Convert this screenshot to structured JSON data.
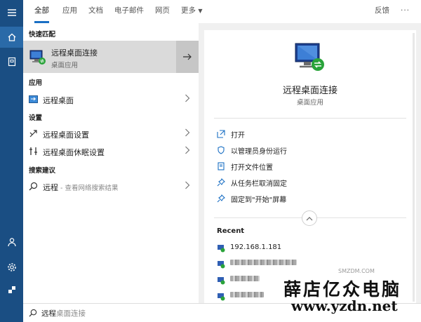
{
  "tabs": [
    {
      "label": "全部"
    },
    {
      "label": "应用"
    },
    {
      "label": "文档"
    },
    {
      "label": "电子邮件"
    },
    {
      "label": "网页"
    },
    {
      "label": "更多"
    }
  ],
  "topbar": {
    "feedback": "反馈",
    "more_dots": "···"
  },
  "best_match": {
    "section": "快速匹配",
    "title": "远程桌面连接",
    "subtitle": "桌面应用"
  },
  "apps": {
    "section": "应用",
    "items": [
      {
        "label": "远程桌面"
      }
    ]
  },
  "settings": {
    "section": "设置",
    "items": [
      {
        "label": "远程桌面设置"
      },
      {
        "label": "远程桌面休眠设置"
      }
    ]
  },
  "suggestions": {
    "section": "搜索建议",
    "items": [
      {
        "label": "远程",
        "hint": " - 查看网络搜索结果"
      }
    ]
  },
  "detail": {
    "title": "远程桌面连接",
    "subtitle": "桌面应用",
    "actions": [
      {
        "label": "打开",
        "icon": "open-icon"
      },
      {
        "label": "以管理员身份运行",
        "icon": "admin-shield-icon"
      },
      {
        "label": "打开文件位置",
        "icon": "file-location-icon"
      },
      {
        "label": "从任务栏取消固定",
        "icon": "unpin-icon"
      },
      {
        "label": "固定到\"开始\"屏幕",
        "icon": "pin-icon"
      }
    ],
    "recent_title": "Recent",
    "recent": [
      {
        "label": "192.168.1.181"
      }
    ]
  },
  "search": {
    "typed": "远程",
    "completion": "桌面连接"
  },
  "watermark": {
    "line1": "薛店亿众电脑",
    "line2": "www.yzdn.net",
    "small": "SMZDM.COM"
  },
  "colors": {
    "rail": "#1a4e83",
    "accent": "#1a6fc4",
    "selected": "#dadada"
  }
}
